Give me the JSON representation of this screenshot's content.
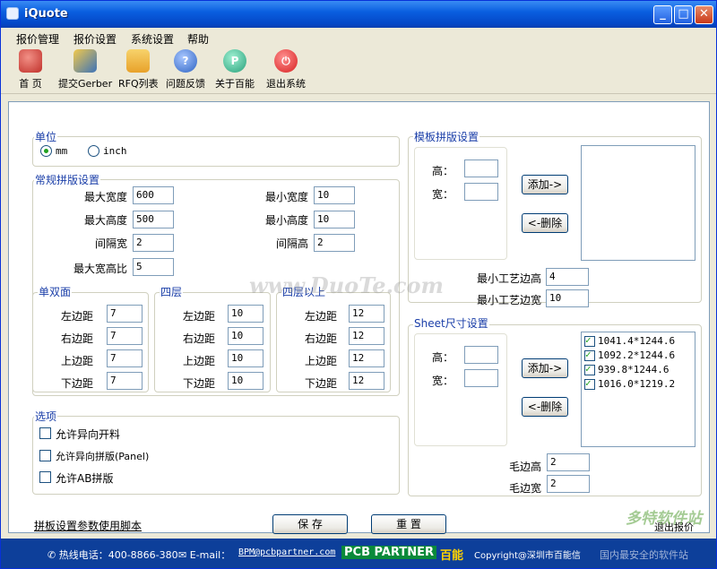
{
  "window": {
    "title": "iQuote",
    "min": "_",
    "max": "□",
    "close": "✕"
  },
  "menu": [
    "报价管理",
    "报价设置",
    "系统设置",
    "帮助"
  ],
  "toolbar": [
    {
      "label": "首  页",
      "icon": "home-icon",
      "color": "#c0302a"
    },
    {
      "label": "提交Gerber",
      "icon": "upload-icon",
      "color": "#3c73b8"
    },
    {
      "label": "RFQ列表",
      "icon": "folder-icon",
      "color": "#f2b640"
    },
    {
      "label": "问题反馈",
      "icon": "help-icon",
      "color": "#2c62c2"
    },
    {
      "label": "关于百能",
      "icon": "info-icon",
      "color": "#27a07a"
    },
    {
      "label": "退出系统",
      "icon": "exit-icon",
      "color": "#d72020"
    }
  ],
  "unit": {
    "title": "单位",
    "mm": "mm",
    "inch": "inch",
    "selected": "mm"
  },
  "regular": {
    "title": "常规拼版设置",
    "max_width_label": "最大宽度",
    "max_width": "600",
    "max_height_label": "最大高度",
    "max_height": "500",
    "gap_width_label": "间隔宽",
    "gap_width": "2",
    "ratio_label": "最大宽高比",
    "ratio": "5",
    "min_width_label": "最小宽度",
    "min_width": "10",
    "min_height_label": "最小高度",
    "min_height": "10",
    "gap_height_label": "间隔高",
    "gap_height": "2"
  },
  "margins": {
    "left_label": "左边距",
    "right_label": "右边距",
    "top_label": "上边距",
    "bottom_label": "下边距",
    "groups": [
      {
        "title": "单双面",
        "left": "7",
        "right": "7",
        "top": "7",
        "bottom": "7"
      },
      {
        "title": "四层",
        "left": "10",
        "right": "10",
        "top": "10",
        "bottom": "10"
      },
      {
        "title": "四层以上",
        "left": "12",
        "right": "12",
        "top": "12",
        "bottom": "12"
      }
    ]
  },
  "options": {
    "title": "选项",
    "items": [
      {
        "label": "允许异向开料",
        "checked": false
      },
      {
        "label": "允许异向拼版(Panel)",
        "checked": false
      },
      {
        "label": "允许AB拼版",
        "checked": false
      }
    ]
  },
  "template": {
    "title": "模板拼版设置",
    "height_label": "高：",
    "width_label": "宽：",
    "height": "",
    "width": "",
    "add_label": "添加->",
    "delete_label": "<-删除",
    "min_height_label": "最小工艺边高",
    "min_height": "4",
    "min_width_label": "最小工艺边宽",
    "min_width": "10"
  },
  "sheet": {
    "title": "Sheet尺寸设置",
    "height_label": "高：",
    "width_label": "宽：",
    "height": "",
    "width": "",
    "add_label": "添加->",
    "delete_label": "<-删除",
    "items": [
      "1041.4*1244.6",
      "1092.2*1244.6",
      "939.8*1244.6",
      "1016.0*1219.2"
    ],
    "edge_height_label": "毛边高",
    "edge_height": "2",
    "edge_width_label": "毛边宽",
    "edge_width": "2"
  },
  "footer": {
    "script_link": "拼板设置参数使用脚本",
    "save": "保 存",
    "reset": "重 置",
    "hint": "退出报价"
  },
  "status": {
    "phone": "热线电话：400-8866-380",
    "email": "E-mail：",
    "email_addr": "BPM@pcbpartner.com",
    "brand": "PCB PARTNER",
    "brand_cn": "百能",
    "copyright": "Copyright@深圳市百能信"
  },
  "watermarks": {
    "center": "www.DuoTe.com",
    "corner": "多特软件站",
    "corner_sub": "国内最安全的软件站"
  }
}
